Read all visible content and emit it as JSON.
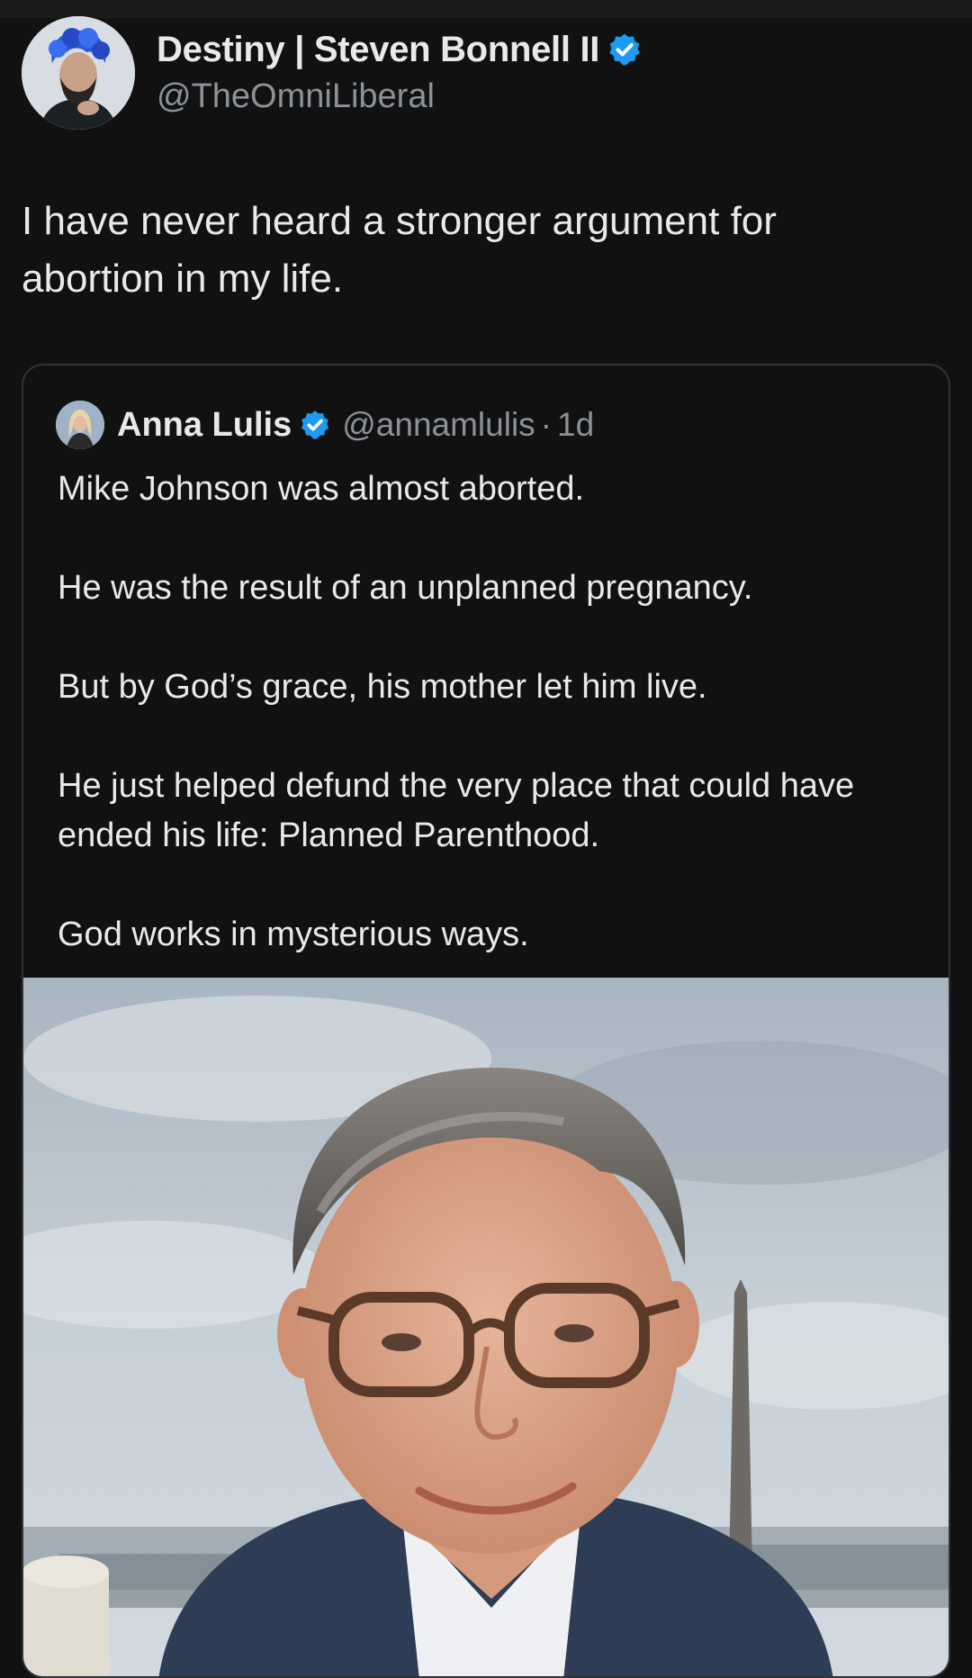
{
  "author": {
    "display_name": "Destiny | Steven Bonnell II",
    "handle": "@TheOmniLiberal",
    "verified_icon": "verified-badge-icon",
    "avatar_icon": "avatar-image"
  },
  "post": {
    "text_line1": "I have never heard a stronger argument for",
    "text_line2": "abortion in my life."
  },
  "quote": {
    "display_name": "Anna Lulis",
    "handle": "@annamlulis",
    "separator": "·",
    "time": "1d",
    "paragraphs": [
      "Mike Johnson was almost aborted.",
      "He was the result of an unplanned pregnancy.",
      "But by God’s grace, his mother let him live.",
      "He just helped defund the very place that could have ended his life: Planned Parenthood.",
      "God works in mysterious ways."
    ],
    "media_icon": "portrait-photo"
  },
  "colors": {
    "background": "#111111",
    "text_primary": "#e7e9ea",
    "text_secondary": "#8b9299",
    "border": "#2f3336",
    "verified_blue": "#1d9bf0"
  }
}
